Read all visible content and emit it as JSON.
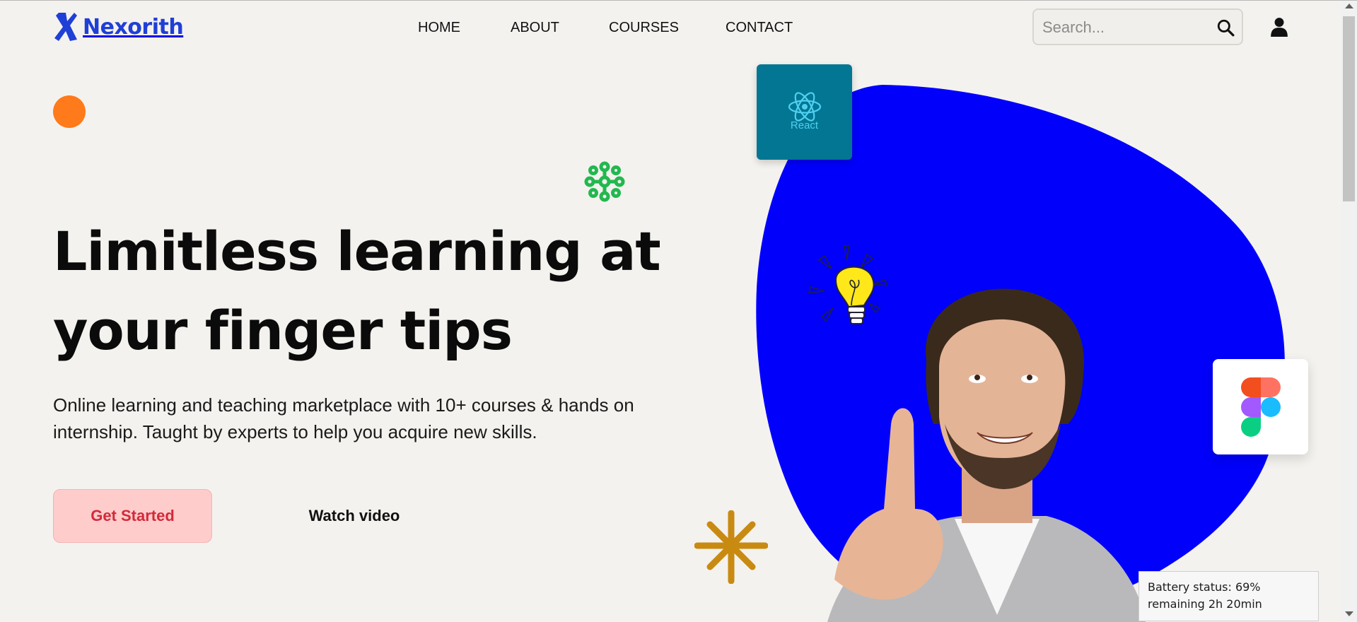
{
  "brand": {
    "name": "Nexorith",
    "logo_color": "#1f3fd6"
  },
  "nav": {
    "items": [
      "HOME",
      "ABOUT",
      "COURSES",
      "CONTACT"
    ]
  },
  "search": {
    "placeholder": "Search...",
    "value": ""
  },
  "icons": {
    "search": "search-icon",
    "account": "user-icon"
  },
  "hero": {
    "headline": "Limitless learning at your finger tips",
    "subtext": "Online learning and teaching marketplace with 10+ courses & hands on internship. Taught by experts to help you acquire new skills.",
    "primary_cta": "Get Started",
    "secondary_cta": "Watch video"
  },
  "badges": {
    "react_label": "React"
  },
  "tooltip": {
    "battery": "Battery status: 69% remaining 2h 20min"
  },
  "colors": {
    "background": "#f4f2ee",
    "accent_blue": "#0000fb",
    "cta_bg": "#ffcccc",
    "cta_text": "#d22a3a",
    "orange_dot": "#ff7a1a",
    "green_deco": "#22b84f",
    "gold_star": "#c98a12",
    "react_card": "#037693"
  }
}
